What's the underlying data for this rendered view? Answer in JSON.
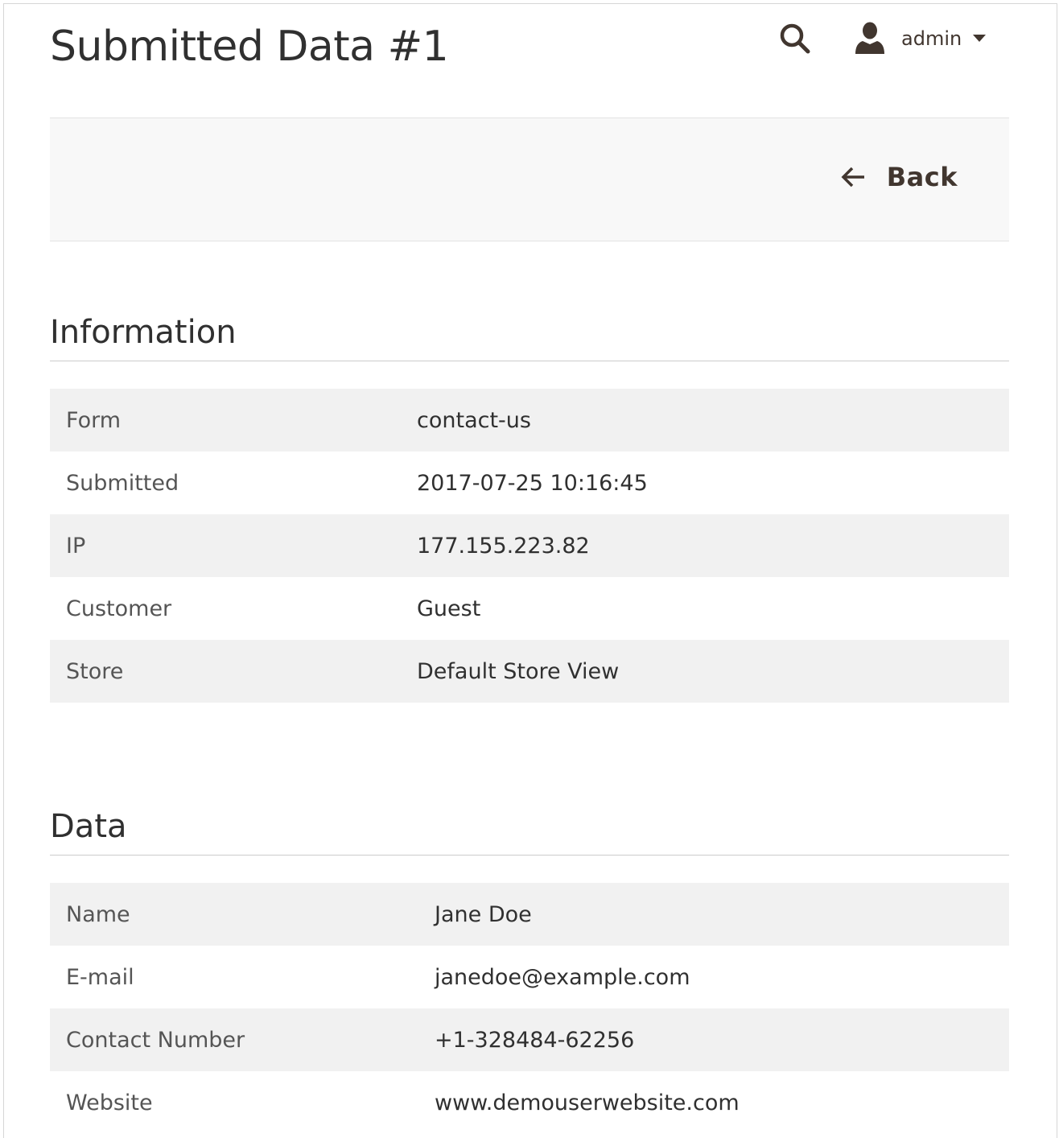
{
  "header": {
    "title": "Submitted Data #1",
    "user_name": "admin"
  },
  "actions": {
    "back_label": "Back"
  },
  "information": {
    "title": "Information",
    "rows": [
      {
        "label": "Form",
        "value": "contact-us"
      },
      {
        "label": "Submitted",
        "value": "2017-07-25 10:16:45"
      },
      {
        "label": "IP",
        "value": "177.155.223.82"
      },
      {
        "label": "Customer",
        "value": "Guest"
      },
      {
        "label": "Store",
        "value": "Default Store View"
      }
    ]
  },
  "data": {
    "title": "Data",
    "rows": [
      {
        "label": "Name",
        "value": "Jane Doe"
      },
      {
        "label": "E-mail",
        "value": "janedoe@example.com"
      },
      {
        "label": "Contact Number",
        "value": "+1-328484-62256"
      },
      {
        "label": "Website",
        "value": "www.demouserwebsite.com"
      }
    ]
  },
  "icons": {
    "search": "search-icon",
    "user": "user-icon",
    "caret": "caret-down-icon",
    "back": "arrow-left-icon"
  },
  "colors": {
    "text": "#303030",
    "label": "#555555",
    "row_alt": "#f1f1f1",
    "actions_bg": "#f8f8f8"
  }
}
